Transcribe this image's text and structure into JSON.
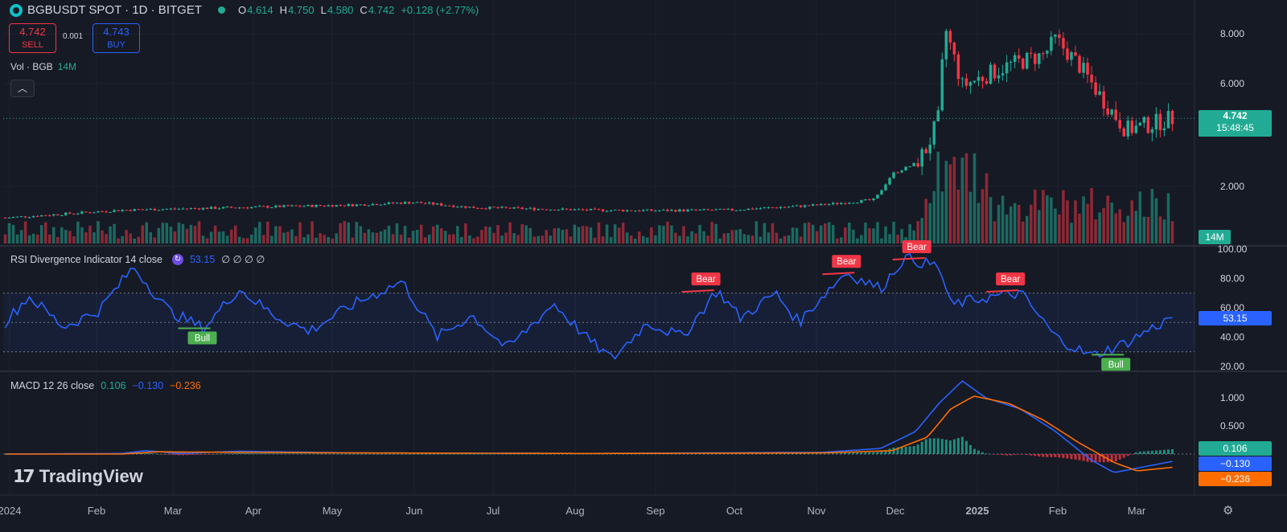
{
  "header": {
    "symbol": "BGBUSDT SPOT · 1D · BITGET",
    "ohlc": {
      "o_label": "O",
      "o": "4.614",
      "h_label": "H",
      "h": "4.750",
      "l_label": "L",
      "l": "4.580",
      "c_label": "C",
      "c": "4.742",
      "change": "+0.128 (+2.77%)"
    }
  },
  "trade": {
    "sell_price": "4.742",
    "sell_label": "SELL",
    "spread": "0.001",
    "buy_price": "4.743",
    "buy_label": "BUY"
  },
  "volume_label": {
    "name": "Vol · BGB",
    "value": "14M"
  },
  "rsi_label": {
    "name": "RSI Divergence Indicator 14 close",
    "value": "53.15",
    "extra": "∅ ∅ ∅ ∅"
  },
  "macd_label": {
    "name": "MACD 12 26 close",
    "macd": "0.106",
    "signal": "−0.130",
    "hist": "−0.236"
  },
  "brand": "TradingView",
  "price_tags": {
    "last": "4.742",
    "countdown": "15:48:45",
    "volume": "14M",
    "rsi": "53.15",
    "macd": "0.106",
    "macd_signal": "−0.130",
    "macd_hist": "−0.236"
  },
  "colors": {
    "bg": "#161a25",
    "up": "#22ab94",
    "down": "#f23645",
    "rsi": "#2962ff",
    "macd": "#2962ff",
    "signal": "#ff6d00",
    "grid": "#2a2e39"
  },
  "chart_data": [
    {
      "type": "candlestick",
      "title": "BGBUSDT SPOT · 1D · BITGET",
      "x": [
        "2024",
        "Feb",
        "Mar",
        "Apr",
        "May",
        "Jun",
        "Jul",
        "Aug",
        "Sep",
        "Oct",
        "Nov",
        "Dec",
        "2025",
        "Feb",
        "Mar"
      ],
      "price_axis_ticks": [
        "8.000",
        "6.000",
        "2.000"
      ],
      "ylim": [
        0,
        8.5
      ],
      "price_path": [
        [
          0,
          0.9
        ],
        [
          0.1,
          1.2
        ],
        [
          0.2,
          1.3
        ],
        [
          0.3,
          1.4
        ],
        [
          0.35,
          1.5
        ],
        [
          0.4,
          1.3
        ],
        [
          0.5,
          1.2
        ],
        [
          0.55,
          1.18
        ],
        [
          0.62,
          1.2
        ],
        [
          0.7,
          1.4
        ],
        [
          0.745,
          1.6
        ],
        [
          0.76,
          2.6
        ],
        [
          0.78,
          3.0
        ],
        [
          0.79,
          3.6
        ],
        [
          0.8,
          4.8
        ],
        [
          0.805,
          8.3
        ],
        [
          0.82,
          6.0
        ],
        [
          0.86,
          6.8
        ],
        [
          0.89,
          7.2
        ],
        [
          0.9,
          7.8
        ],
        [
          0.92,
          6.8
        ],
        [
          0.94,
          5.5
        ],
        [
          0.96,
          4.3
        ],
        [
          0.98,
          4.5
        ],
        [
          1.0,
          4.742
        ]
      ],
      "last": 4.742
    },
    {
      "type": "bar",
      "title": "Vol · BGB",
      "note": "daily volume bars"
    },
    {
      "type": "line",
      "title": "RSI Divergence Indicator 14 close",
      "ylim": [
        20,
        100
      ],
      "y_ticks": [
        "100.00",
        "80.00",
        "60.00",
        "40.00",
        "20.00"
      ],
      "bands": [
        30,
        70
      ],
      "last": 53.15,
      "markers": [
        {
          "label": "Bull",
          "x": 0.17,
          "y": 46
        },
        {
          "label": "Bear",
          "x": 0.6,
          "y": 72
        },
        {
          "label": "Bear",
          "x": 0.72,
          "y": 84
        },
        {
          "label": "Bear",
          "x": 0.78,
          "y": 94
        },
        {
          "label": "Bear",
          "x": 0.86,
          "y": 72
        },
        {
          "label": "Bull",
          "x": 0.95,
          "y": 28
        }
      ]
    },
    {
      "type": "line",
      "title": "MACD 12 26 close",
      "ylim": [
        -0.35,
        1.5
      ],
      "y_ticks": [
        "1.000",
        "0.500"
      ],
      "series": [
        {
          "name": "MACD",
          "values_hint": "peaks ~1.3 at 2025, dips to -0.3 late Feb"
        },
        {
          "name": "Signal",
          "values_hint": "peaks ~1.0 at 2025"
        }
      ]
    }
  ]
}
